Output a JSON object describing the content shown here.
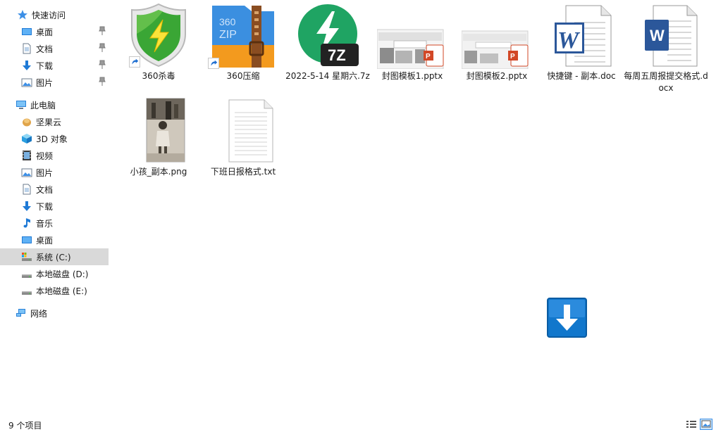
{
  "nav": {
    "quick_access": "快速访问",
    "quick_items": [
      "桌面",
      "文档",
      "下载",
      "图片"
    ],
    "this_pc": "此电脑",
    "pc_items": [
      "坚果云",
      "3D 对象",
      "视频",
      "图片",
      "文档",
      "下载",
      "音乐",
      "桌面",
      "系统 (C:)",
      "本地磁盘 (D:)",
      "本地磁盘 (E:)"
    ],
    "network": "网络",
    "selected": "系统 (C:)"
  },
  "files": [
    {
      "name": "360杀毒",
      "icon": "shield-icon"
    },
    {
      "name": "360压缩",
      "icon": "zip-archive-icon"
    },
    {
      "name": "2022-5-14 星期六.7z",
      "icon": "7z-archive-icon"
    },
    {
      "name": "封图模板1.pptx",
      "icon": "pptx-icon"
    },
    {
      "name": "封图模板2.pptx",
      "icon": "pptx-icon"
    },
    {
      "name": "快捷键 - 副本.doc",
      "icon": "doc-icon"
    },
    {
      "name": "每周五周报提交格式.docx",
      "icon": "docx-icon"
    },
    {
      "name": "小孩_副本.png",
      "icon": "photo-thumbnail"
    },
    {
      "name": "下班日报格式.txt",
      "icon": "txt-icon"
    }
  ],
  "thumb_text": {
    "zip_brand_top": "360",
    "zip_brand_bottom": "ZIP",
    "sevenz": "7Z",
    "word_w": "W"
  },
  "status": {
    "item_count": "9 个项目"
  },
  "colors": {
    "selected_bg": "#d9d9d9",
    "shield_green": "#3aa635",
    "zip_blue": "#3b8fe0",
    "zip_orange": "#f39a1e",
    "sevenz_green": "#1fa463",
    "ppt_red": "#d24726",
    "word_blue": "#2b579a",
    "download_blue": "#1177cc"
  }
}
